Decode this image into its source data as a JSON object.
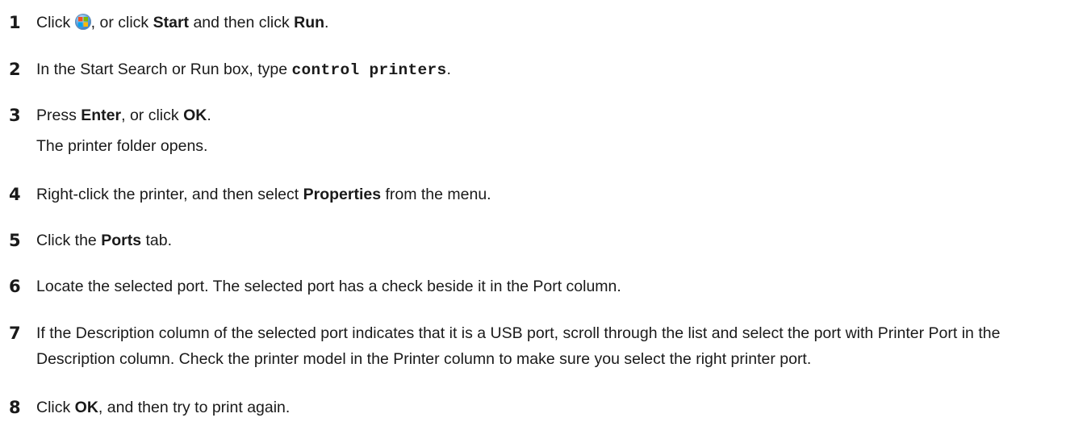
{
  "steps": [
    {
      "number": "1",
      "parts": {
        "pre": "Click ",
        "icon": "windows-start-orb-icon",
        "mid1": ", or click ",
        "b1": "Start",
        "mid2": " and then click ",
        "b2": "Run",
        "post": "."
      }
    },
    {
      "number": "2",
      "parts": {
        "pre": "In the Start Search or Run box, type ",
        "code": "control printers",
        "post": "."
      }
    },
    {
      "number": "3",
      "parts": {
        "pre": "Press ",
        "b1": "Enter",
        "mid1": ", or click ",
        "b2": "OK",
        "post": "."
      },
      "note": "The printer folder opens."
    },
    {
      "number": "4",
      "parts": {
        "pre": "Right-click the printer, and then select ",
        "b1": "Properties",
        "post": " from the menu."
      }
    },
    {
      "number": "5",
      "parts": {
        "pre": "Click the ",
        "b1": "Ports",
        "post": " tab."
      }
    },
    {
      "number": "6",
      "text": "Locate the selected port. The selected port has a check beside it in the Port column."
    },
    {
      "number": "7",
      "text": "If the Description column of the selected port indicates that it is a USB port, scroll through the list and select the port with Printer Port in the Description column. Check the printer model in the Printer column to make sure you select the right printer port."
    },
    {
      "number": "8",
      "parts": {
        "pre": "Click ",
        "b1": "OK",
        "post": ", and then try to print again."
      }
    }
  ]
}
